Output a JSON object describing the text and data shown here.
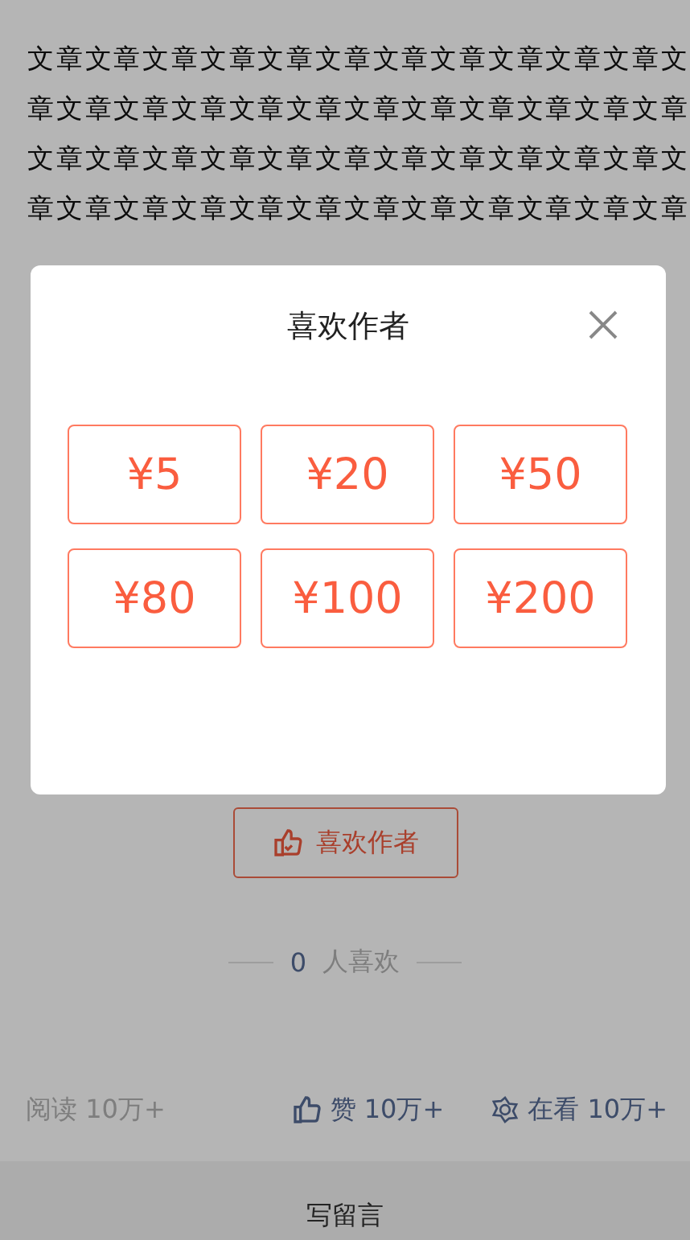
{
  "article": {
    "lines": [
      "文章文章文章文章文章文章文章文章文章文章文章文",
      "章文章文章文章文章文章文章文章文章文章文章文章",
      "文章文章文章文章文章文章文章文章文章文章文章文",
      "章文章文章文章文章文章文章文章文章文章文章文章"
    ]
  },
  "like_button": {
    "label": "喜欢作者"
  },
  "likes": {
    "count": "0",
    "label": "人喜欢"
  },
  "stats": {
    "read_label": "阅读",
    "read_value": "10万+",
    "like_label": "赞",
    "like_value": "10万+",
    "watching_label": "在看",
    "watching_value": "10万+"
  },
  "comment_bar": {
    "label": "写留言"
  },
  "modal": {
    "title": "喜欢作者",
    "amounts": [
      "¥5",
      "¥20",
      "¥50",
      "¥80",
      "¥100",
      "¥200"
    ]
  }
}
